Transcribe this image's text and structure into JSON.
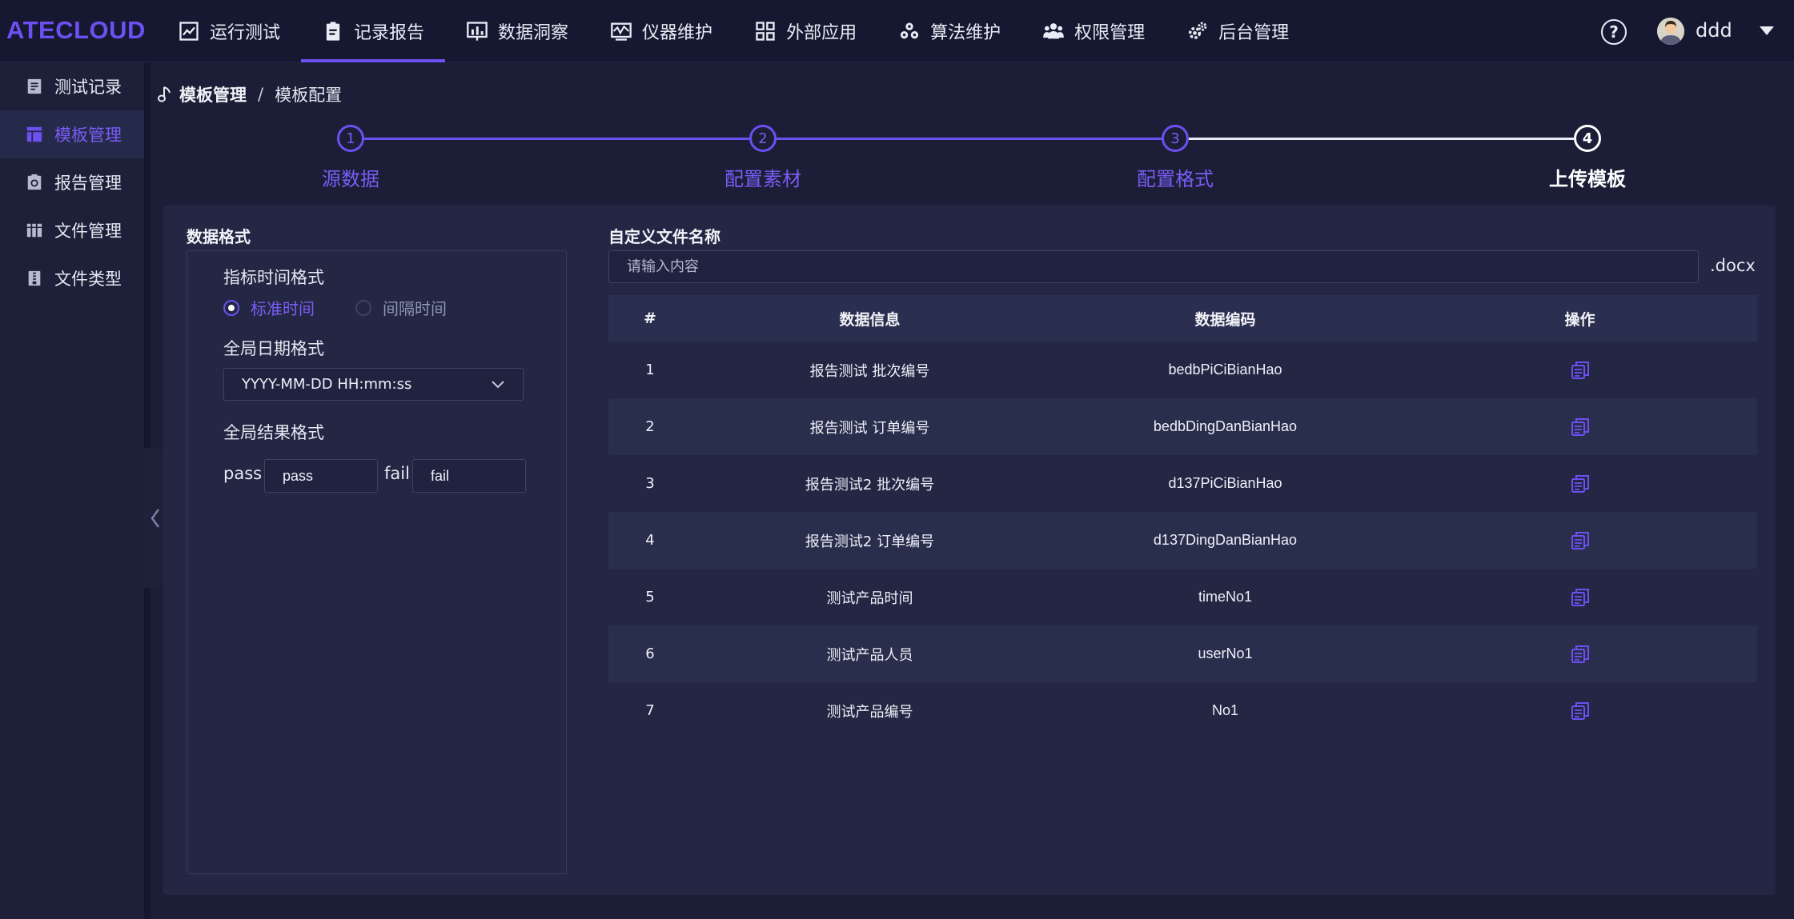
{
  "app": {
    "logo": "ATECLOUD"
  },
  "nav": {
    "items": [
      {
        "label": "运行测试",
        "icon": "chart-line-icon"
      },
      {
        "label": "记录报告",
        "icon": "clipboard-icon",
        "active": true
      },
      {
        "label": "数据洞察",
        "icon": "bar-chart-icon"
      },
      {
        "label": "仪器维护",
        "icon": "monitor-wave-icon"
      },
      {
        "label": "外部应用",
        "icon": "grid-icon"
      },
      {
        "label": "算法维护",
        "icon": "cubes-icon"
      },
      {
        "label": "权限管理",
        "icon": "users-icon"
      },
      {
        "label": "后台管理",
        "icon": "gears-icon"
      }
    ],
    "help": "?",
    "username": "ddd"
  },
  "sidebar": {
    "items": [
      {
        "label": "测试记录",
        "icon": "document-icon"
      },
      {
        "label": "模板管理",
        "icon": "template-icon",
        "active": true
      },
      {
        "label": "报告管理",
        "icon": "report-icon"
      },
      {
        "label": "文件管理",
        "icon": "folder-icon"
      },
      {
        "label": "文件类型",
        "icon": "file-type-icon"
      }
    ]
  },
  "breadcrumb": {
    "parent": "模板管理",
    "separator": "/",
    "current": "模板配置"
  },
  "steps": [
    {
      "num": "1",
      "label": "源数据"
    },
    {
      "num": "2",
      "label": "配置素材"
    },
    {
      "num": "3",
      "label": "配置格式"
    },
    {
      "num": "4",
      "label": "上传模板"
    }
  ],
  "format": {
    "title": "数据格式",
    "time_format_label": "指标时间格式",
    "radio_standard": "标准时间",
    "radio_interval": "间隔时间",
    "date_format_label": "全局日期格式",
    "date_format_value": "YYYY-MM-DD HH:mm:ss",
    "result_format_label": "全局结果格式",
    "pass_label": "pass",
    "pass_value": "pass",
    "fail_label": "fail",
    "fail_value": "fail"
  },
  "filename": {
    "title": "自定义文件名称",
    "placeholder": "请输入内容",
    "suffix": ".docx"
  },
  "table": {
    "headers": {
      "index": "#",
      "info": "数据信息",
      "code": "数据编码",
      "action": "操作"
    },
    "rows": [
      {
        "index": "1",
        "info": "报告测试 批次编号",
        "code": "bedbPiCiBianHao"
      },
      {
        "index": "2",
        "info": "报告测试 订单编号",
        "code": "bedbDingDanBianHao"
      },
      {
        "index": "3",
        "info": "报告测试2 批次编号",
        "code": "d137PiCiBianHao"
      },
      {
        "index": "4",
        "info": "报告测试2 订单编号",
        "code": "d137DingDanBianHao"
      },
      {
        "index": "5",
        "info": "测试产品时间",
        "code": "timeNo1"
      },
      {
        "index": "6",
        "info": "测试产品人员",
        "code": "userNo1"
      },
      {
        "index": "7",
        "info": "测试产品编号",
        "code": "No1"
      }
    ]
  },
  "colors": {
    "accent": "#6d50f2",
    "background": "#1b1e36",
    "card": "#232743"
  }
}
